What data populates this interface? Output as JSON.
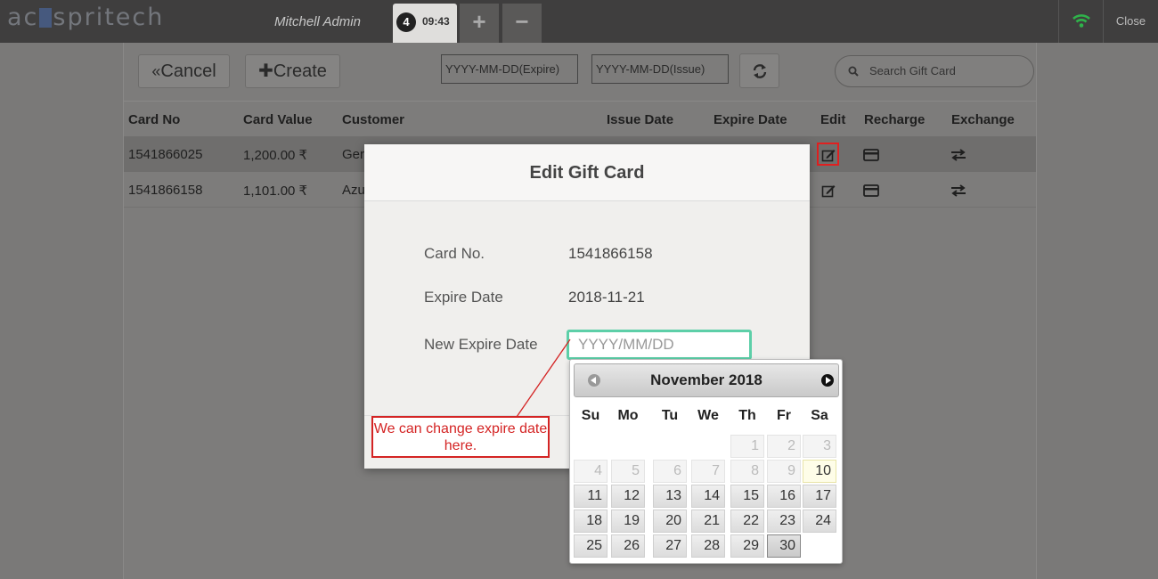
{
  "topbar": {
    "logo": "acespritech",
    "user": "Mitchell Admin",
    "order_number": "4",
    "order_time": "09:43",
    "add_label": "+",
    "remove_label": "−",
    "close_label": "Close"
  },
  "toolbar": {
    "cancel_label": "Cancel",
    "create_label": "Create",
    "expire_placeholder": "YYYY-MM-DD(Expire)",
    "issue_placeholder": "YYYY-MM-DD(Issue)",
    "search_placeholder": "Search Gift Card"
  },
  "table": {
    "headers": [
      "Card No",
      "Card Value",
      "Customer",
      "Issue Date",
      "Expire Date",
      "Edit",
      "Recharge",
      "Exchange"
    ],
    "rows": [
      {
        "card_no": "1541866025",
        "card_value": "1,200.00 ₹",
        "customer": "Ger"
      },
      {
        "card_no": "1541866158",
        "card_value": "1,101.00 ₹",
        "customer": "Azu"
      }
    ]
  },
  "modal": {
    "title": "Edit Gift Card",
    "card_no_label": "Card No.",
    "card_no_value": "1541866158",
    "expire_label": "Expire Date",
    "expire_value": "2018-11-21",
    "new_expire_label": "New Expire Date",
    "new_expire_placeholder": "YYYY/MM/DD"
  },
  "annotation": {
    "text": "We can change expire date here."
  },
  "datepicker": {
    "title": "November 2018",
    "weekdays": [
      "Su",
      "Mo",
      "Tu",
      "We",
      "Th",
      "Fr",
      "Sa"
    ],
    "days": [
      "1",
      "2",
      "3",
      "4",
      "5",
      "6",
      "7",
      "8",
      "9",
      "10",
      "11",
      "12",
      "13",
      "14",
      "15",
      "16",
      "17",
      "18",
      "19",
      "20",
      "21",
      "22",
      "23",
      "24",
      "25",
      "26",
      "27",
      "28",
      "29",
      "30"
    ],
    "today": "10",
    "selected": "30"
  },
  "colors": {
    "accent": "#5dcfa8",
    "annotation": "#d42424",
    "wifi": "#2fb34a"
  }
}
